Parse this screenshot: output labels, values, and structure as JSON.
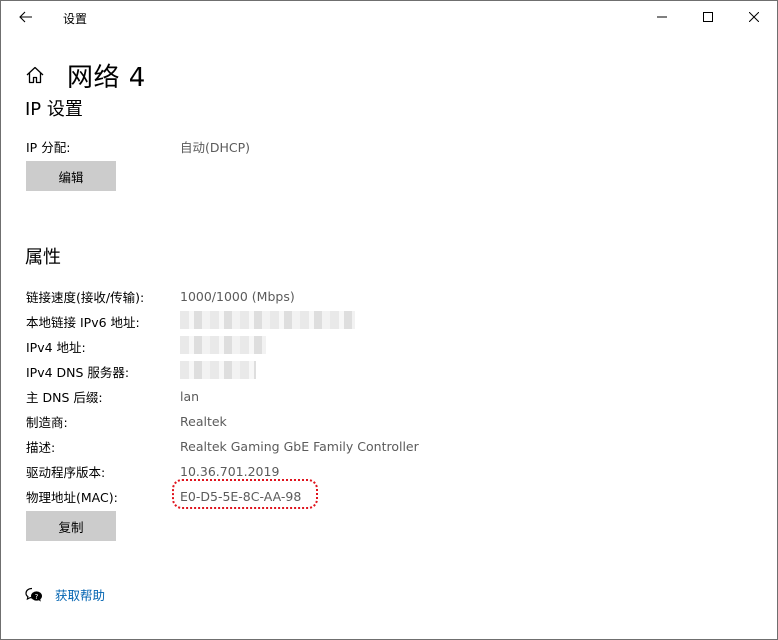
{
  "window": {
    "title": "设置",
    "minimize_label": "minimize",
    "maximize_label": "maximize",
    "close_label": "close"
  },
  "header": {
    "title": "网络 4"
  },
  "ip_section": {
    "title": "IP 设置",
    "assignment_key": "IP 分配:",
    "assignment_value": "自动(DHCP)",
    "edit_button": "编辑"
  },
  "properties": {
    "title": "属性",
    "rows": [
      {
        "key": "链接速度(接收/传输):",
        "value": "1000/1000 (Mbps)"
      },
      {
        "key": "本地链接 IPv6 地址:",
        "value": ""
      },
      {
        "key": "IPv4 地址:",
        "value": ""
      },
      {
        "key": "IPv4 DNS 服务器:",
        "value": ""
      },
      {
        "key": "主 DNS 后缀:",
        "value": "lan"
      },
      {
        "key": "制造商:",
        "value": "Realtek"
      },
      {
        "key": "描述:",
        "value": "Realtek Gaming GbE Family Controller"
      },
      {
        "key": "驱动程序版本:",
        "value": "10.36.701.2019"
      },
      {
        "key": "物理地址(MAC):",
        "value": "E0-D5-5E-8C-AA-98"
      }
    ],
    "copy_button": "复制"
  },
  "help": {
    "label": "获取帮助",
    "icon": "help-chat-icon"
  },
  "colors": {
    "accent": "#0063b1",
    "highlight_ring": "#e0141e",
    "button_bg": "#cccccc"
  }
}
